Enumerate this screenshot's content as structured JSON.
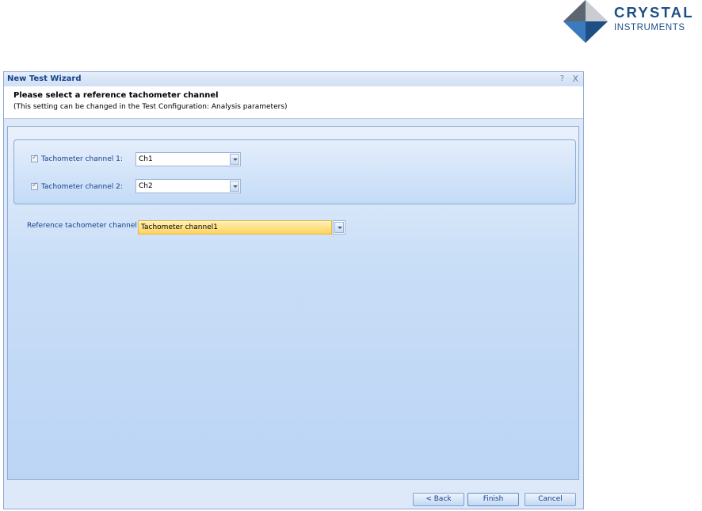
{
  "logo": {
    "line1": "CRYSTAL",
    "line2": "INSTRUMENTS"
  },
  "window": {
    "title": "New Test Wizard",
    "help": "?",
    "close": "X"
  },
  "header": {
    "title": "Please select a reference tachometer channel",
    "subtitle": "(This setting can be changed in the Test Configuration: Analysis parameters)"
  },
  "tachometers": [
    {
      "label": "Tachometer channel 1:",
      "checked": true,
      "value": "Ch1"
    },
    {
      "label": "Tachometer channel 2:",
      "checked": true,
      "value": "Ch2"
    }
  ],
  "reference": {
    "label": "Reference tachometer channel",
    "value": "Tachometer channel1"
  },
  "buttons": {
    "back": "< Back",
    "finish": "Finish",
    "cancel": "Cancel"
  }
}
